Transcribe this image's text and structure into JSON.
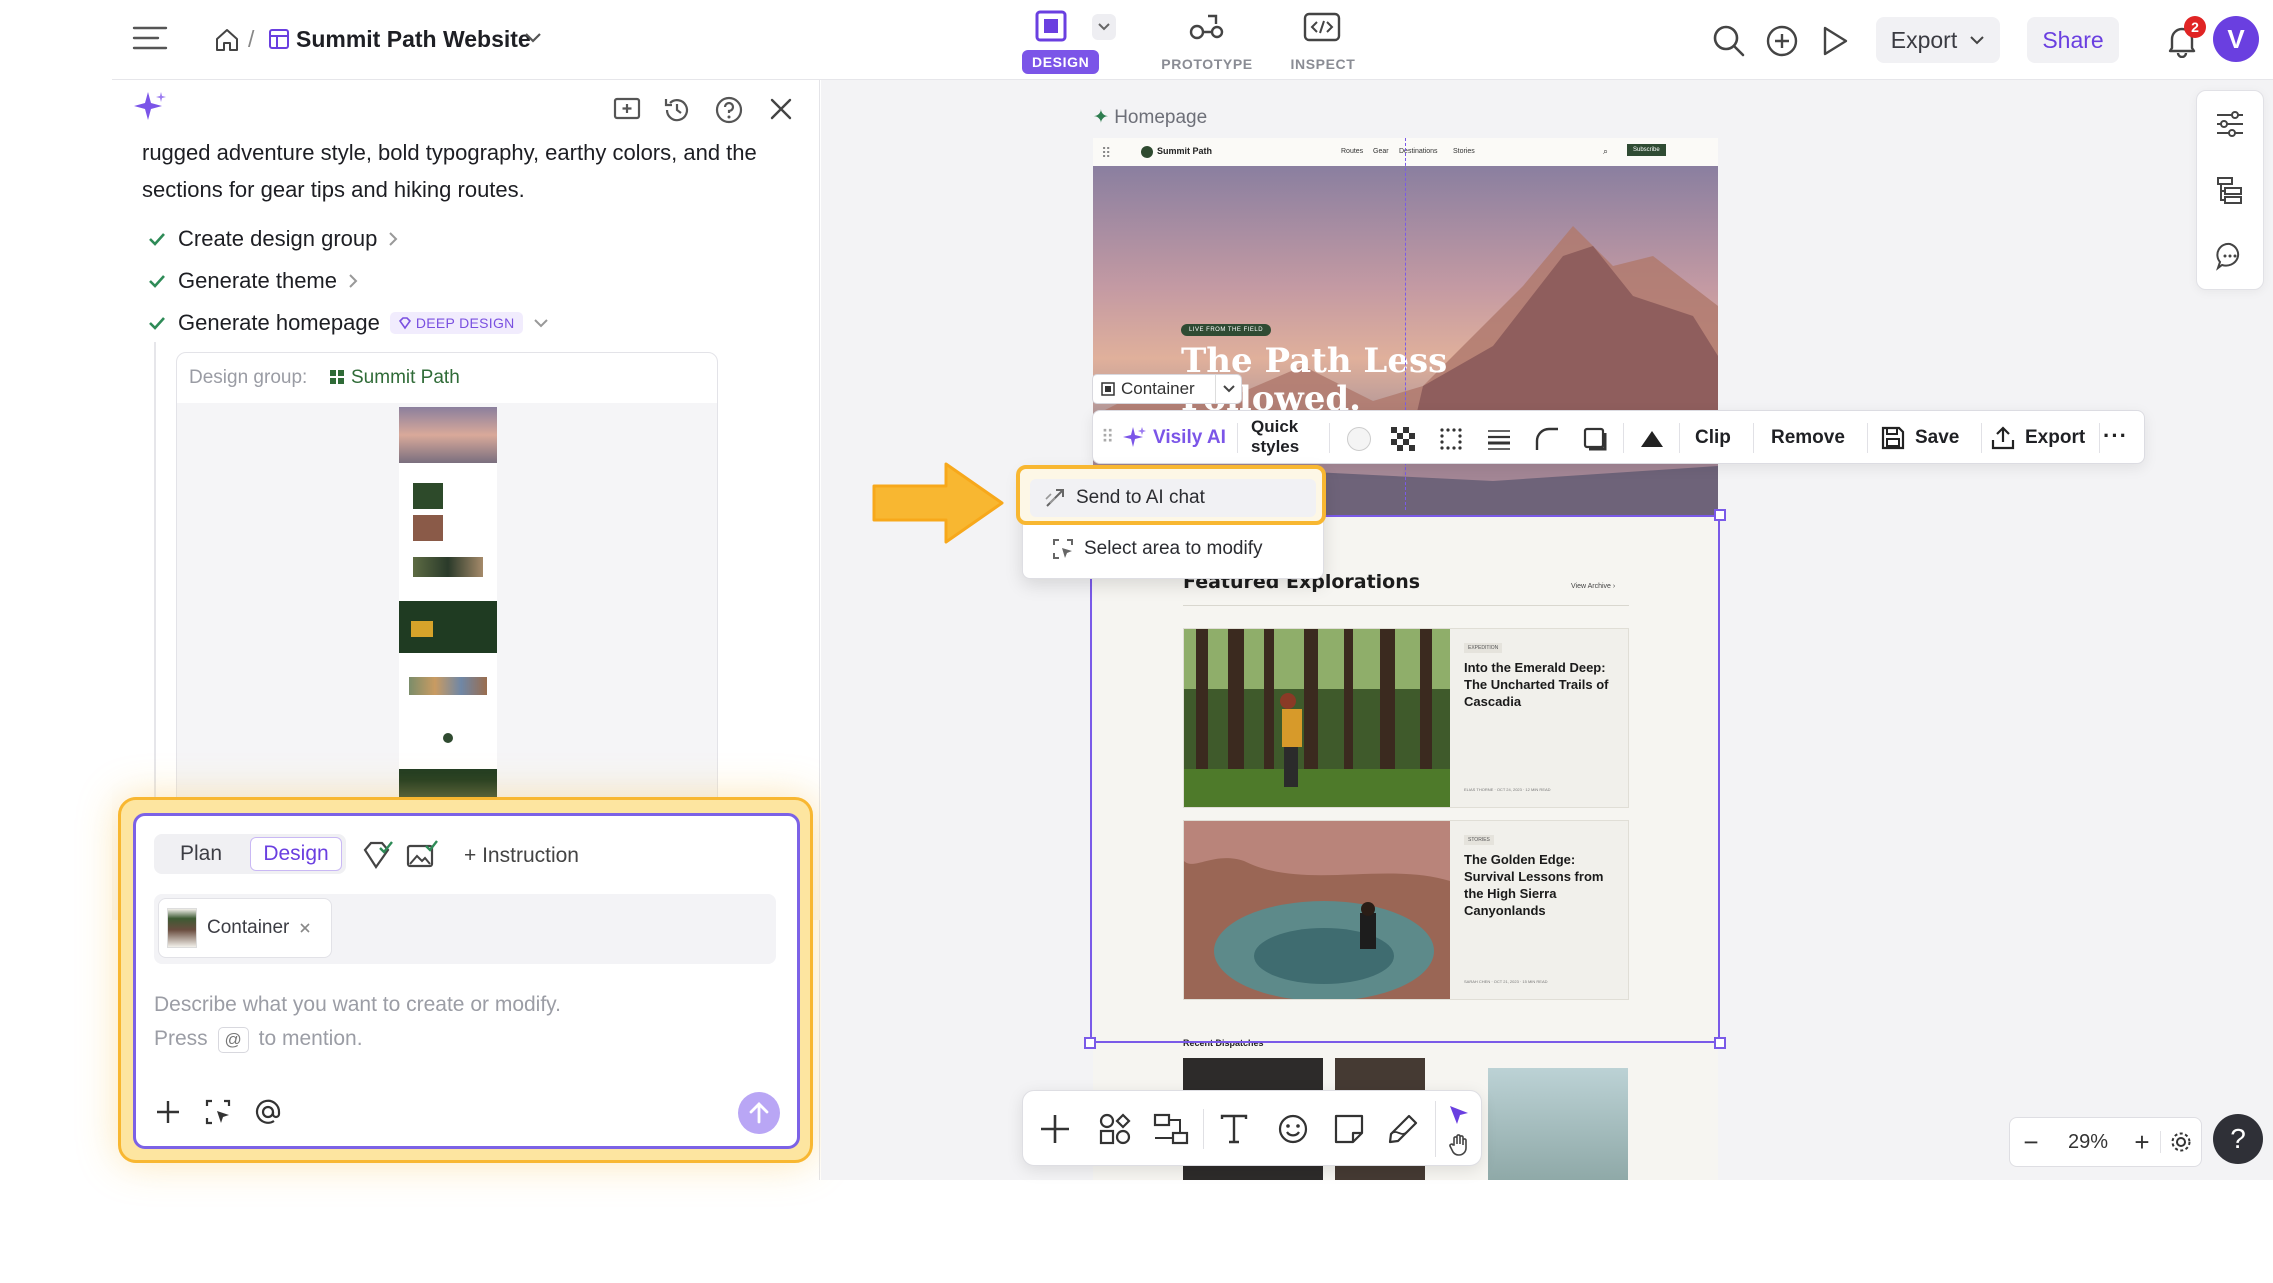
{
  "topbar": {
    "breadcrumb_sep": "/",
    "project_name": "Summit Path Website",
    "tabs": [
      {
        "label": "DESIGN",
        "active": true
      },
      {
        "label": "PROTOTYPE",
        "active": false
      },
      {
        "label": "INSPECT",
        "active": false
      }
    ],
    "export_label": "Export",
    "share_label": "Share",
    "notification_count": "2",
    "avatar_letter": "V"
  },
  "assistant": {
    "intro_text_line1": "rugged adventure style, bold typography, earthy colors, and the",
    "intro_text_line2": "sections for gear tips and hiking routes.",
    "steps": [
      {
        "label": "Create design group",
        "status": "done"
      },
      {
        "label": "Generate theme",
        "status": "done"
      },
      {
        "label": "Generate homepage",
        "status": "done",
        "badge": "DEEP DESIGN"
      }
    ],
    "design_group_label": "Design group:",
    "design_group_name": "Summit Path"
  },
  "chat": {
    "mode_plan": "Plan",
    "mode_design": "Design",
    "instruction_label": "+ Instruction",
    "chip_label": "Container",
    "placeholder_line1": "Describe what you want to create or modify.",
    "placeholder_press": "Press",
    "placeholder_key": "@",
    "placeholder_line2_end": "to mention."
  },
  "canvas": {
    "frame_label": "Homepage",
    "site_brand": "Summit Path",
    "site_nav": [
      "Routes",
      "Gear",
      "Destinations",
      "Stories"
    ],
    "site_cta": "Subscribe",
    "hero_badge": "LIVE FROM THE FIELD",
    "hero_title": "The Path Less Followed.",
    "section_title": "Featured Explorations",
    "view_archive": "View Archive",
    "cards": [
      {
        "tag": "EXPEDITION",
        "title": "Into the Emerald Deep: The Uncharted Trails of Cascadia",
        "meta": "ELIAS THORNE · OCT 24, 2023 · 12 MIN READ"
      },
      {
        "tag": "STORIES",
        "title": "The Golden Edge: Survival Lessons from the High Sierra Canyonlands",
        "meta": "SARAH CHEN · OCT 21, 2023 · 15 MIN READ"
      }
    ],
    "next_section": "Recent Dispatches"
  },
  "element_toolbar": {
    "container_tag": "Container",
    "visily_ai": "Visily AI",
    "quick_styles_line1": "Quick",
    "quick_styles_line2": "styles",
    "clip": "Clip",
    "remove": "Remove",
    "save": "Save",
    "export": "Export"
  },
  "ai_menu": {
    "send_to_chat": "Send to AI chat",
    "select_area": "Select area to modify"
  },
  "zoom": {
    "value": "29%"
  },
  "help": "?",
  "colors": {
    "accent": "#7b55e8",
    "highlight": "#f8b731",
    "success": "#2e8b57"
  }
}
